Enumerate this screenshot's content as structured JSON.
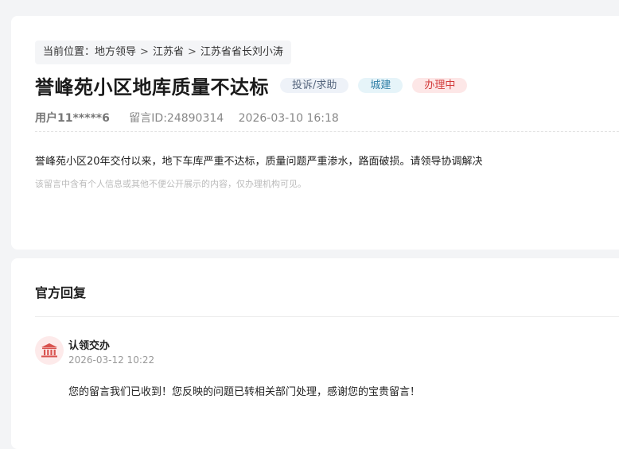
{
  "breadcrumb": {
    "prefix": "当前位置：",
    "items": [
      "地方领导",
      "江苏省",
      "江苏省省长刘小涛"
    ],
    "separator": ">"
  },
  "post": {
    "title": "誉峰苑小区地库质量不达标",
    "tags": {
      "type": "投诉/求助",
      "category": "城建",
      "status": "办理中"
    },
    "user": "用户11*****6",
    "message_id": "留言ID:24890314",
    "datetime": "2026-03-10 16:18",
    "content": "誉峰苑小区20年交付以来，地下车库严重不达标，质量问题严重渗水，路面破损。请领导协调解决",
    "notice": "该留言中含有个人信息或其他不便公开展示的内容，仅办理机构可见。"
  },
  "reply_section": {
    "title": "官方回复",
    "reply": {
      "icon": "government-building-icon",
      "name": "认领交办",
      "datetime": "2026-03-12 10:22",
      "text": "您的留言我们已收到！您反映的问题已转相关部门处理，感谢您的宝贵留言！"
    }
  },
  "colors": {
    "status_red": "#d33b3b",
    "category_blue": "#2e7ea6",
    "icon_red": "#d9534f"
  }
}
